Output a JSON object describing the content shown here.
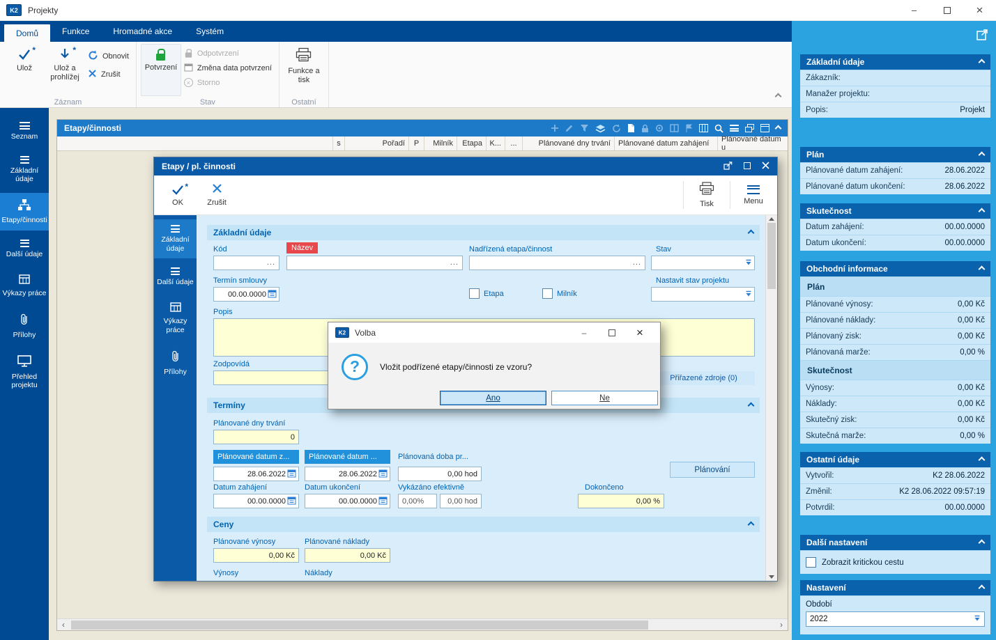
{
  "app": {
    "title": "Projekty"
  },
  "glyphs": {
    "k2": "K2",
    "minimize": "–",
    "close": "×",
    "question": "?",
    "ellipsis": "...",
    "scroll_left": "‹",
    "scroll_right": "›"
  },
  "ribbon": {
    "tabs": [
      {
        "label": "Domů"
      },
      {
        "label": "Funkce"
      },
      {
        "label": "Hromadné akce"
      },
      {
        "label": "Systém"
      }
    ],
    "zaznam": {
      "label": "Záznam",
      "uloz": "Ulož",
      "uloz_a_prohlizej": "Ulož a prohlížej",
      "obnovit": "Obnovit",
      "zrusit": "Zrušit"
    },
    "stav": {
      "label": "Stav",
      "potvrzeni": "Potvrzení",
      "odpotvrzeni": "Odpotvrzení",
      "zmena_data": "Změna data potvrzení",
      "storno": "Storno"
    },
    "ostatni": {
      "label": "Ostatní",
      "funkce_a_tisk": "Funkce a tisk"
    }
  },
  "leftnav": {
    "items": [
      {
        "label": "Seznam"
      },
      {
        "label": "Základní údaje"
      },
      {
        "label": "Etapy/činnosti"
      },
      {
        "label": "Další údaje"
      },
      {
        "label": "Výkazy práce"
      },
      {
        "label": "Přílohy"
      },
      {
        "label": "Přehled projektu"
      }
    ]
  },
  "panel": {
    "title": "Etapy/činnosti",
    "columns": [
      {
        "label": "s"
      },
      {
        "label": "Pořadí"
      },
      {
        "label": "P"
      },
      {
        "label": "Milník"
      },
      {
        "label": "Etapa"
      },
      {
        "label": "K..."
      },
      {
        "label": "..."
      },
      {
        "label": "Plánované dny trvání"
      },
      {
        "label": "Plánované datum zahájení"
      },
      {
        "label": "Plánované datum u"
      }
    ]
  },
  "dialog": {
    "title": "Etapy / pl. činnosti",
    "toolbar": {
      "ok": "OK",
      "zrusit": "Zrušit",
      "tisk": "Tisk",
      "menu": "Menu"
    },
    "nav": [
      {
        "label": "Základní údaje"
      },
      {
        "label": "Další údaje"
      },
      {
        "label": "Výkazy práce"
      },
      {
        "label": "Přílohy"
      }
    ],
    "zakladni": {
      "title": "Základní údaje",
      "kod": "Kód",
      "nazev": "Název",
      "nadrizena": "Nadřízená etapa/činnost",
      "stav": "Stav",
      "termin_smlouvy": "Termín smlouvy",
      "termin_value": "00.00.0000",
      "etapa": "Etapa",
      "milnik": "Milník",
      "nastavit": "Nastavit stav projektu",
      "popis": "Popis",
      "zodpovida": "Zodpovídá",
      "zdroje": "Přiřazené zdroje (0)"
    },
    "terminy": {
      "title": "Termíny",
      "dny": "Plánované dny trvání",
      "dny_value": "0",
      "datum_z": "Plánované datum z...",
      "datum_z_value": "28.06.2022",
      "datum_u": "Plánované datum ...",
      "datum_u_value": "28.06.2022",
      "doba": "Plánovaná doba pr...",
      "doba_value": "0,00 hod",
      "planovani": "Plánování",
      "zahajeni": "Datum zahájení",
      "zahajeni_value": "00.00.0000",
      "ukonceni": "Datum ukončení",
      "ukonceni_value": "00.00.0000",
      "vykazano": "Vykázáno efektivně",
      "vykazano_pct": "0,00%",
      "vykazano_hod": "0,00 hod",
      "dokonceno": "Dokončeno",
      "dokonceno_value": "0,00 %"
    },
    "ceny": {
      "title": "Ceny",
      "vynosy": "Plánované výnosy",
      "vynosy_value": "0,00 Kč",
      "naklady": "Plánované náklady",
      "naklady_value": "0,00 Kč",
      "vynosy2": "Výnosy",
      "naklady2": "Náklady"
    }
  },
  "volba": {
    "title": "Volba",
    "message": "Vložit podřízené etapy/činnosti ze vzoru?",
    "ano": "Ano",
    "ne": "Ne"
  },
  "rightbar": {
    "zakladni": {
      "title": "Základní údaje",
      "rows": [
        {
          "label": "Zákazník:",
          "value": ""
        },
        {
          "label": "Manažer projektu:",
          "value": ""
        },
        {
          "label": "Popis:",
          "value": "Projekt"
        }
      ]
    },
    "plan": {
      "title": "Plán",
      "rows": [
        {
          "label": "Plánované datum zahájení:",
          "value": "28.06.2022"
        },
        {
          "label": "Plánované datum ukončení:",
          "value": "28.06.2022"
        }
      ]
    },
    "skutecnost": {
      "title": "Skutečnost",
      "rows": [
        {
          "label": "Datum zahájení:",
          "value": "00.00.0000"
        },
        {
          "label": "Datum ukončení:",
          "value": "00.00.0000"
        }
      ]
    },
    "obchodni": {
      "title": "Obchodní informace",
      "sub_plan": "Plán",
      "plan_rows": [
        {
          "label": "Plánované výnosy:",
          "value": "0,00 Kč"
        },
        {
          "label": "Plánované náklady:",
          "value": "0,00 Kč"
        },
        {
          "label": "Plánovaný zisk:",
          "value": "0,00 Kč"
        },
        {
          "label": "Plánovaná marže:",
          "value": "0,00 %"
        }
      ],
      "sub_skutecnost": "Skutečnost",
      "skutecnost_rows": [
        {
          "label": "Výnosy:",
          "value": "0,00 Kč"
        },
        {
          "label": "Náklady:",
          "value": "0,00 Kč"
        },
        {
          "label": "Skutečný zisk:",
          "value": "0,00 Kč"
        },
        {
          "label": "Skutečná marže:",
          "value": "0,00 %"
        }
      ]
    },
    "ostatni": {
      "title": "Ostatní údaje",
      "rows": [
        {
          "label": "Vytvořil:",
          "value": "K2 28.06.2022"
        },
        {
          "label": "Změnil:",
          "value": "K2 28.06.2022 09:57:19"
        },
        {
          "label": "Potvrdil:",
          "value": "00.00.0000"
        }
      ]
    },
    "dalsi": {
      "title": "Další nastavení",
      "checkbox": "Zobrazit kritickou cestu"
    },
    "nastaveni": {
      "title": "Nastavení",
      "obdobi": "Období",
      "obdobi_value": "2022"
    }
  },
  "colors": {
    "accent": "#004a93",
    "panel_blue": "#1d7ac9",
    "cyan": "#2ba3e1",
    "input_yellow": "#ffffd6",
    "red_label": "#e8474b"
  }
}
